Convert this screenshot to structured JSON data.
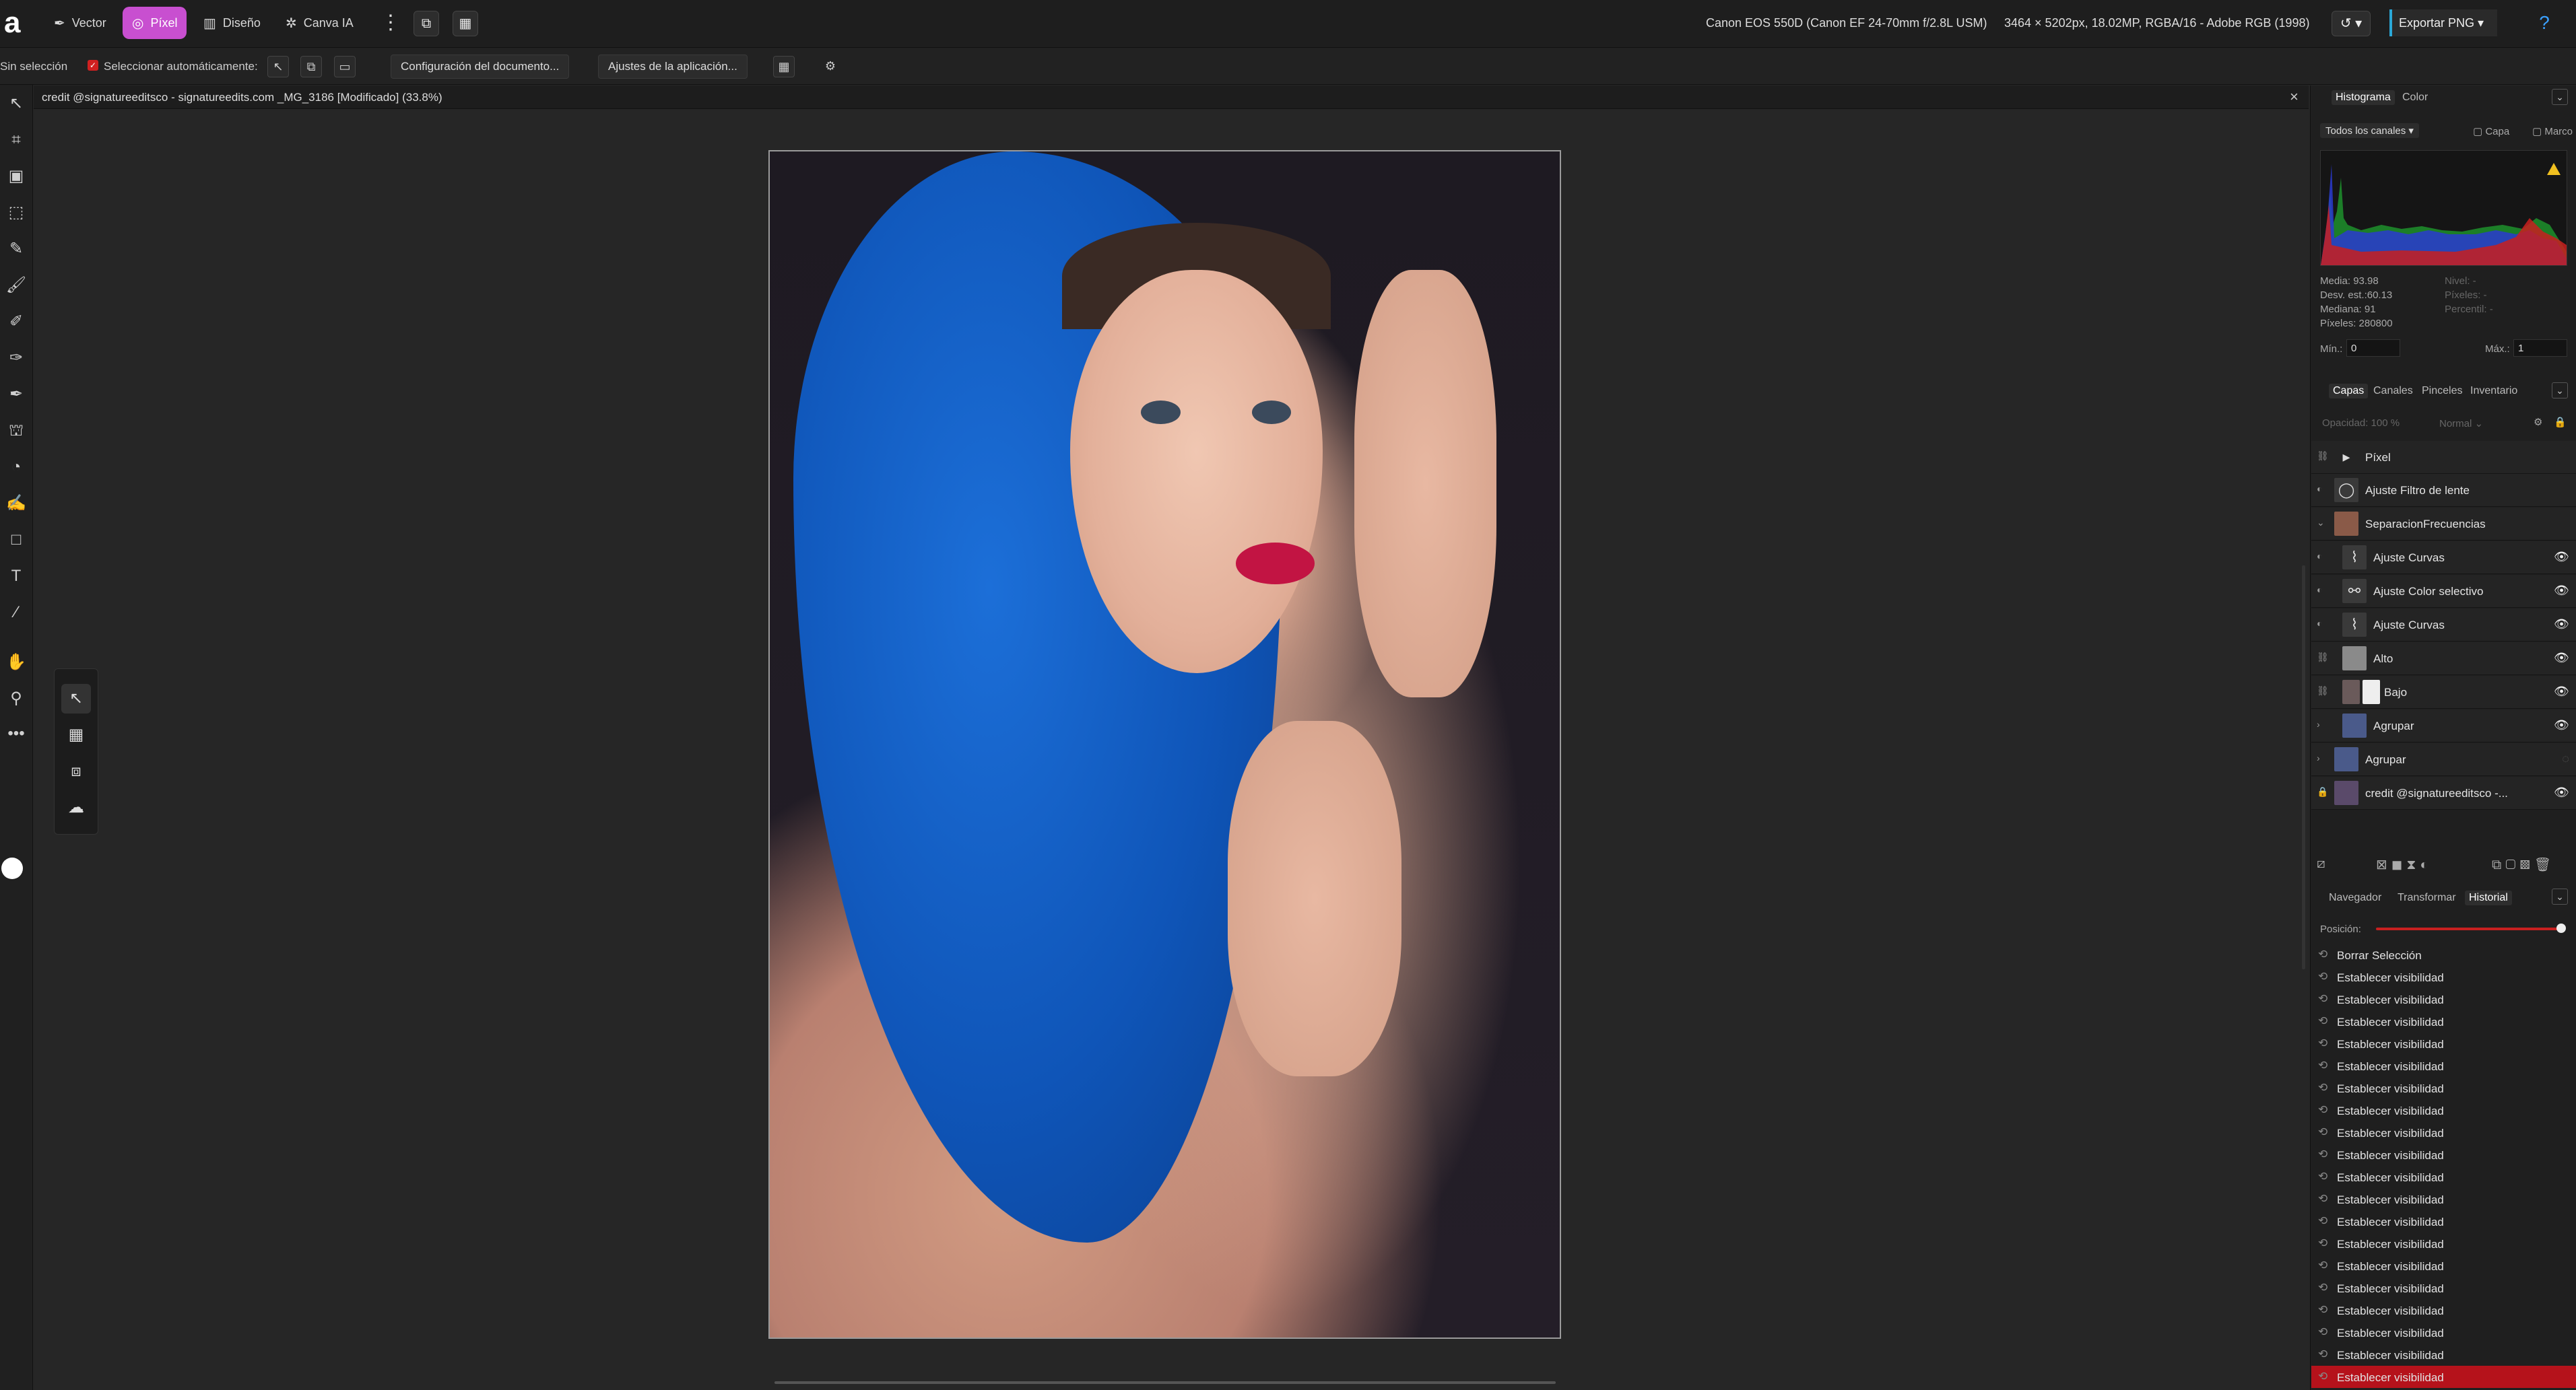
{
  "topbar": {
    "modes": [
      {
        "label": "Vector",
        "icon": "vector-pen-icon"
      },
      {
        "label": "Píxel",
        "icon": "pixel-brush-icon"
      },
      {
        "label": "Diseño",
        "icon": "layout-icon"
      },
      {
        "label": "Canva IA",
        "icon": "sparkle-icon"
      }
    ],
    "camera": "Canon EOS 550D (Canon EF 24-70mm f/2.8L USM)",
    "image_info": "3464 × 5202px, 18.02MP, RGBA/16 - Adobe RGB (1998)",
    "export_label": "Exportar PNG",
    "help": "?"
  },
  "context": {
    "selection": "Sin selección",
    "auto_select": "Seleccionar automáticamente:",
    "doc_settings": "Configuración del documento...",
    "app_settings": "Ajustes de la aplicación..."
  },
  "document": {
    "title": "credit @signatureeditsco - signatureedits.com _MG_3186 [Modificado] (33.8%)"
  },
  "histogram_panel": {
    "tabs": [
      "Histograma",
      "Color"
    ],
    "channel": "Todos los canales",
    "opt_layer": "Capa",
    "opt_frame": "Marco",
    "stats_left": [
      "Media: 93.98",
      "Desv. est.:60.13",
      "Mediana: 91",
      "Píxeles: 280800"
    ],
    "stats_right": [
      "Nivel: -",
      "Píxeles: -",
      "Percentil: -"
    ],
    "min_label": "Mín.:",
    "min_value": "0",
    "max_label": "Máx.:",
    "max_value": "1",
    "colors": {
      "red": "#e02020",
      "green": "#20c020",
      "blue": "#3050ff"
    }
  },
  "layers_panel": {
    "tabs": [
      "Capas",
      "Canales",
      "Pinceles",
      "Inventario"
    ],
    "opacity": "Opacidad: 100 %",
    "blend": "Normal",
    "layers": [
      {
        "name": "Píxel",
        "dim": true
      },
      {
        "name": "Ajuste Filtro de lente"
      },
      {
        "name": "SeparacionFrecuencias"
      },
      {
        "name": "Ajuste Curvas"
      },
      {
        "name": "Ajuste Color selectivo"
      },
      {
        "name": "Ajuste Curvas"
      },
      {
        "name": "Alto"
      },
      {
        "name": "Bajo"
      },
      {
        "name": "Agrupar",
        "dim": true
      },
      {
        "name": "Agrupar",
        "dim": true
      },
      {
        "name": "credit @signatureeditsco -..."
      }
    ]
  },
  "history_panel": {
    "tabs": [
      "Navegador",
      "Transformar",
      "Historial"
    ],
    "position_label": "Posición:",
    "position_fraction": 1.0,
    "items": [
      "Borrar Selección",
      "Establecer visibilidad",
      "Establecer visibilidad",
      "Establecer visibilidad",
      "Establecer visibilidad",
      "Establecer visibilidad",
      "Establecer visibilidad",
      "Establecer visibilidad",
      "Establecer visibilidad",
      "Establecer visibilidad",
      "Establecer visibilidad",
      "Establecer visibilidad",
      "Establecer visibilidad",
      "Establecer visibilidad",
      "Establecer visibilidad",
      "Establecer visibilidad",
      "Establecer visibilidad",
      "Establecer visibilidad",
      "Establecer visibilidad",
      "Establecer visibilidad"
    ]
  }
}
